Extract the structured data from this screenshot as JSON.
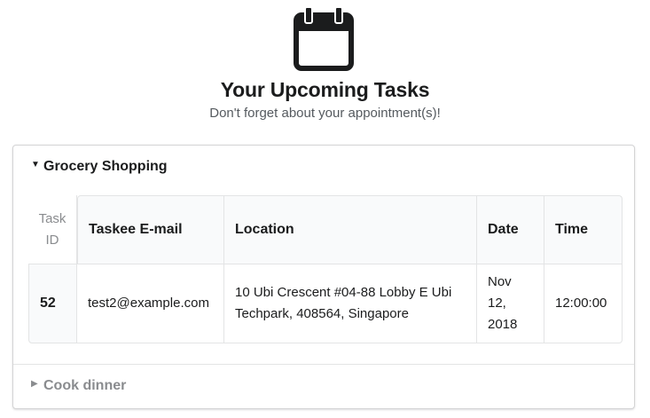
{
  "header": {
    "icon": "calendar-icon",
    "title": "Your Upcoming Tasks",
    "subtitle": "Don't forget about your appointment(s)!"
  },
  "accordion": {
    "items": [
      {
        "title": "Grocery Shopping",
        "expanded": true,
        "table": {
          "columns": {
            "id": "Task ID",
            "email": "Taskee E-mail",
            "location": "Location",
            "date": "Date",
            "time": "Time"
          },
          "rows": [
            {
              "id": "52",
              "email": "test2@example.com",
              "location": "10 Ubi Crescent #04-88 Lobby E Ubi Techpark, 408564, Singapore",
              "date": "Nov 12, 2018",
              "time": "12:00:00"
            }
          ]
        }
      },
      {
        "title": "Cook dinner",
        "expanded": false
      }
    ]
  },
  "colors": {
    "text": "#1b1c1d",
    "muted": "#8a8c8f",
    "border": "#d4d4d5",
    "table_header_bg": "#f9fafb"
  }
}
